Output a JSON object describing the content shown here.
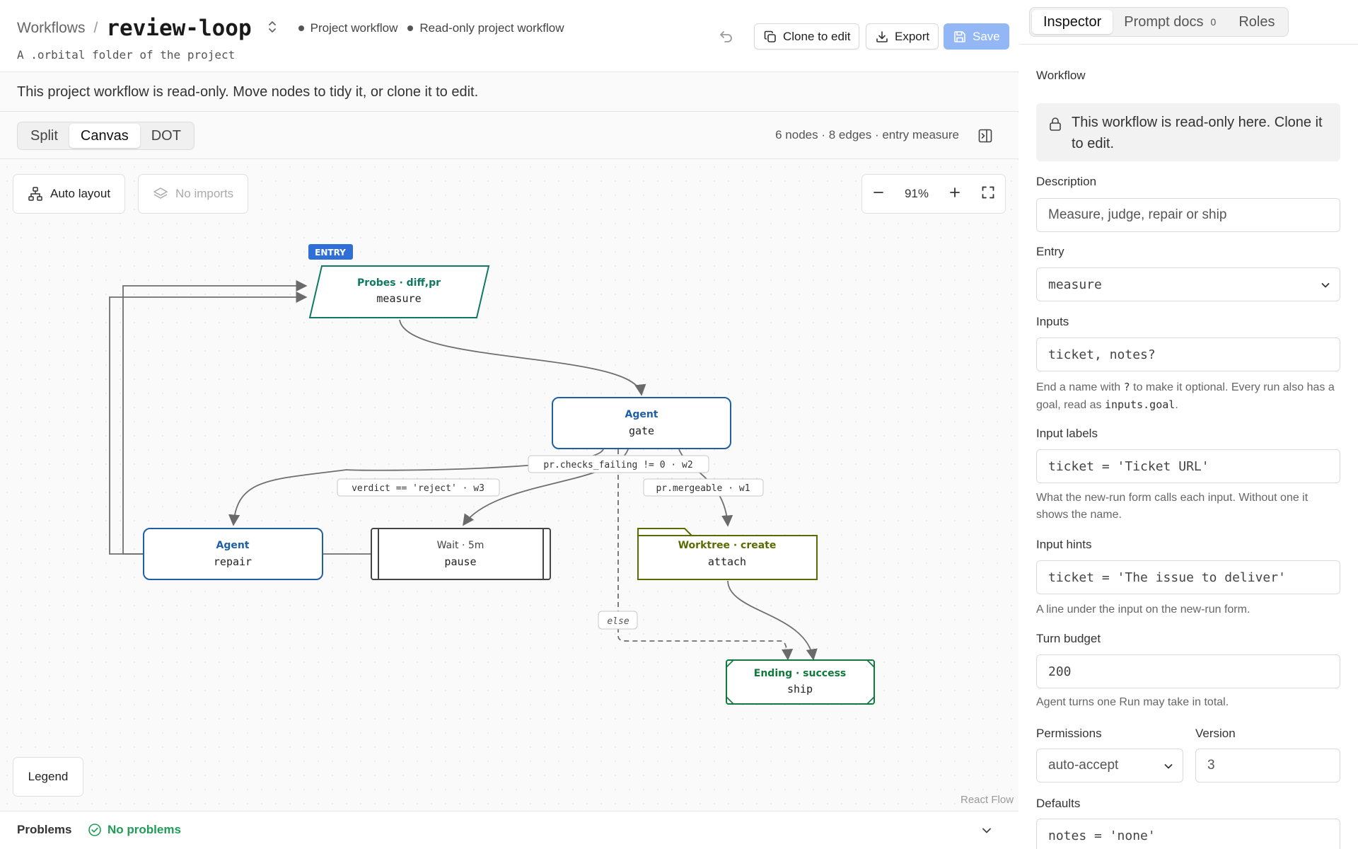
{
  "header": {
    "breadcrumb_root": "Workflows",
    "separator": "/",
    "title": "review-loop",
    "meta_project": "Project workflow",
    "meta_readonly": "Read-only project workflow",
    "subtitle": "A .orbital folder of the project",
    "clone_label": "Clone to edit",
    "export_label": "Export",
    "save_label": "Save"
  },
  "banner": {
    "text": "This project workflow is read-only. Move nodes to tidy it, or clone it to edit."
  },
  "view": {
    "modes": [
      "Split",
      "Canvas",
      "DOT"
    ],
    "active_mode": "Canvas",
    "stats": "6 nodes · 8 edges · entry measure"
  },
  "canvas": {
    "auto_layout_label": "Auto layout",
    "no_imports_label": "No imports",
    "zoom_level": "91%",
    "legend_label": "Legend",
    "attribution": "React Flow",
    "entry_badge": "ENTRY",
    "nodes": [
      {
        "id": "measure",
        "kind": "Probes · diff,pr",
        "name": "measure",
        "color": "#0f7a63"
      },
      {
        "id": "gate",
        "kind": "Agent",
        "name": "gate",
        "color": "#1f5fa8"
      },
      {
        "id": "repair",
        "kind": "Agent",
        "name": "repair",
        "color": "#1f5fa8"
      },
      {
        "id": "pause",
        "kind": "Wait · 5m",
        "name": "pause",
        "color": "#444444"
      },
      {
        "id": "attach",
        "kind": "Worktree · create",
        "name": "attach",
        "color": "#5a6b00"
      },
      {
        "id": "ship",
        "kind": "Ending · success",
        "name": "ship",
        "color": "#0f7a3c"
      }
    ],
    "edge_labels": {
      "checks": "pr.checks_failing != 0 · w2",
      "reject": "verdict == 'reject' · w3",
      "mergeable": "pr.mergeable · w1",
      "else": "else"
    }
  },
  "problems": {
    "label": "Problems",
    "status": "No problems"
  },
  "inspector": {
    "tabs": [
      "Inspector",
      "Prompt docs",
      "Roles"
    ],
    "prompt_docs_count": "0",
    "active_tab": "Inspector",
    "section_title": "Workflow",
    "readonly_note": "This workflow is read-only here. Clone it to edit.",
    "description_label": "Description",
    "description_value": "Measure, judge, repair or ship",
    "entry_label": "Entry",
    "entry_value": "measure",
    "inputs_label": "Inputs",
    "inputs_value": "ticket, notes?",
    "inputs_hint_a": "End a name with",
    "inputs_hint_q": "?",
    "inputs_hint_b": "to make it optional. Every run also has a goal, read as",
    "inputs_hint_code": "inputs.goal",
    "inputs_hint_c": ".",
    "input_labels_label": "Input labels",
    "input_labels_value": "ticket = 'Ticket URL'",
    "input_labels_hint": "What the new-run form calls each input. Without one it shows the name.",
    "input_hints_label": "Input hints",
    "input_hints_value": "ticket = 'The issue to deliver'",
    "input_hints_hint": "A line under the input on the new-run form.",
    "turn_budget_label": "Turn budget",
    "turn_budget_value": "200",
    "turn_budget_hint": "Agent turns one Run may take in total.",
    "permissions_label": "Permissions",
    "permissions_value": "auto-accept",
    "version_label": "Version",
    "version_value": "3",
    "defaults_label": "Defaults",
    "defaults_value": "notes = 'none'"
  }
}
